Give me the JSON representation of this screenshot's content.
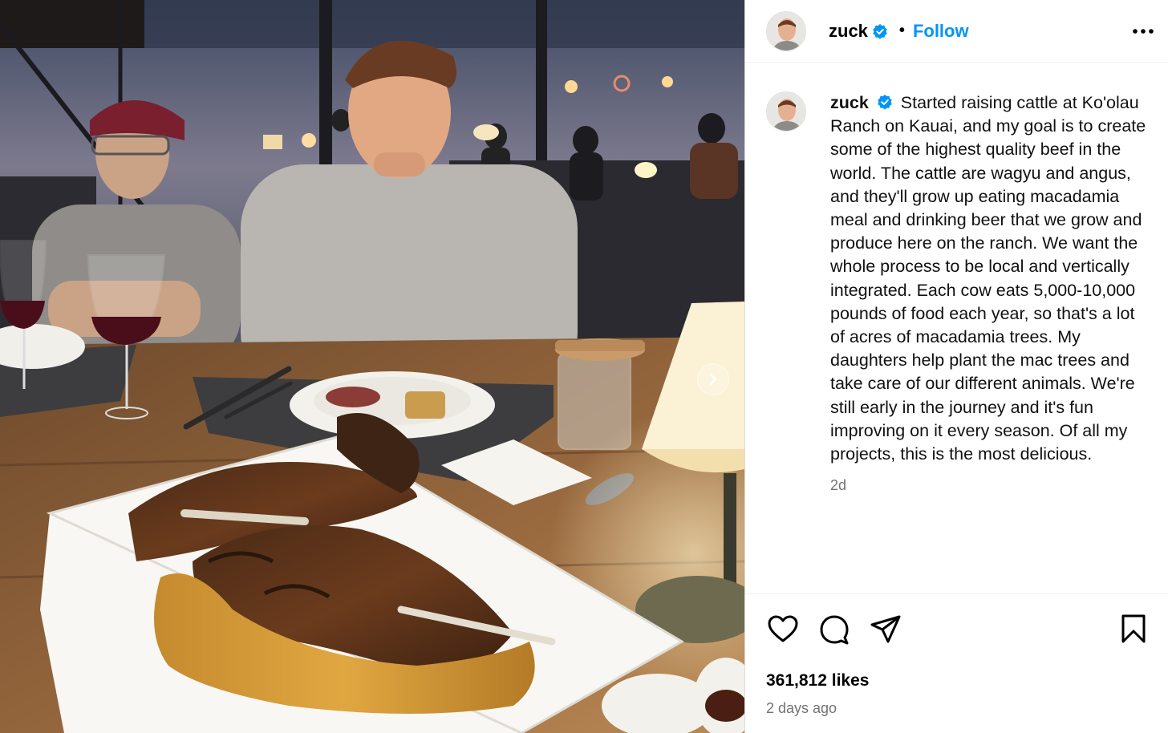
{
  "header": {
    "username": "zuck",
    "separator": "•",
    "follow_label": "Follow"
  },
  "caption": {
    "username": "zuck",
    "text": "Started raising cattle at Ko'olau Ranch on Kauai, and my goal is to create some of the highest quality beef in the world. The cattle are wagyu and angus, and they'll grow up eating macadamia meal and drinking beer that we grow and produce here on the ranch. We want the whole process to be local and vertically integrated. Each cow eats 5,000-10,000 pounds of food each year, so that's a lot of acres of macadamia trees. My daughters help plant the mac trees and take care of our different animals. We're still early in the journey and it's fun improving on it every season. Of all my projects, this is the most delicious.",
    "time": "2d"
  },
  "stats": {
    "likes": "361,812 likes",
    "time_ago": "2 days ago"
  },
  "icons": {
    "verified": "verified-badge-icon",
    "more": "more-options-icon",
    "like": "heart-icon",
    "comment": "comment-icon",
    "share": "share-icon",
    "save": "bookmark-icon",
    "next": "chevron-right-icon"
  },
  "colors": {
    "accent": "#0095f6",
    "muted": "#737373",
    "verified": "#0095f6"
  }
}
